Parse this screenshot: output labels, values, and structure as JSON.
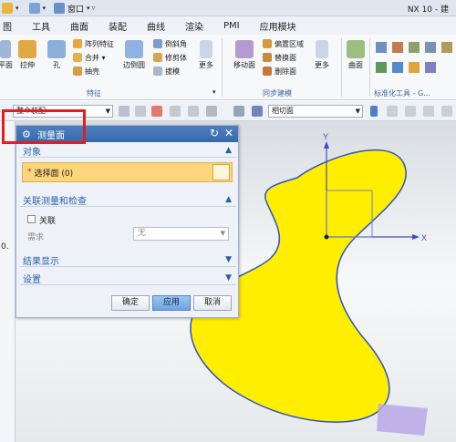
{
  "window": {
    "app_title": "NX 10 - 建"
  },
  "quick_access": {
    "window_menu": "窗口"
  },
  "menu": [
    "图",
    "工具",
    "曲面",
    "装配",
    "曲线",
    "渲染",
    "PMI",
    "应用模块"
  ],
  "ribbon": {
    "large_buttons": [
      {
        "label": "平面"
      },
      {
        "label": "拉伸"
      },
      {
        "label": "孔"
      },
      {
        "label": "边倒圆"
      },
      {
        "label": "更多"
      },
      {
        "label": "移动面"
      },
      {
        "label": "更多"
      },
      {
        "label": "曲面"
      }
    ],
    "small_items": [
      {
        "label": "阵列特征"
      },
      {
        "label": "合并 ▾"
      },
      {
        "label": "抽壳"
      },
      {
        "label": "倒斜角"
      },
      {
        "label": "修剪体"
      },
      {
        "label": "拔模"
      },
      {
        "label": "偏置区域"
      },
      {
        "label": "替换面"
      },
      {
        "label": "删除面"
      }
    ],
    "groups": {
      "feature": "特征",
      "sync": "同步建模",
      "std": "标准化工具 - G..."
    }
  },
  "toolbar": {
    "filter_value": "整个装配",
    "cut_plane_value": "相切面"
  },
  "left_panel": {
    "value": "0."
  },
  "dialog": {
    "title": "测量面",
    "sections": {
      "object": "对象",
      "assoc": "关联测量和检查",
      "results": "结果显示",
      "settings": "设置"
    },
    "select_face_label": "选择面 (0)",
    "required_marker": "*",
    "associative_label": "关联",
    "requirement_label": "需求",
    "requirement_value": "无",
    "buttons": {
      "ok": "确定",
      "apply": "应用",
      "cancel": "取消"
    }
  },
  "csys": {
    "x_label": "X",
    "y_label": "Y"
  },
  "colors": {
    "shape_fill": "#ffee00",
    "shape_outline": "#2b55c2",
    "dialog_header": "#3568ad",
    "highlight": "#e02020"
  }
}
